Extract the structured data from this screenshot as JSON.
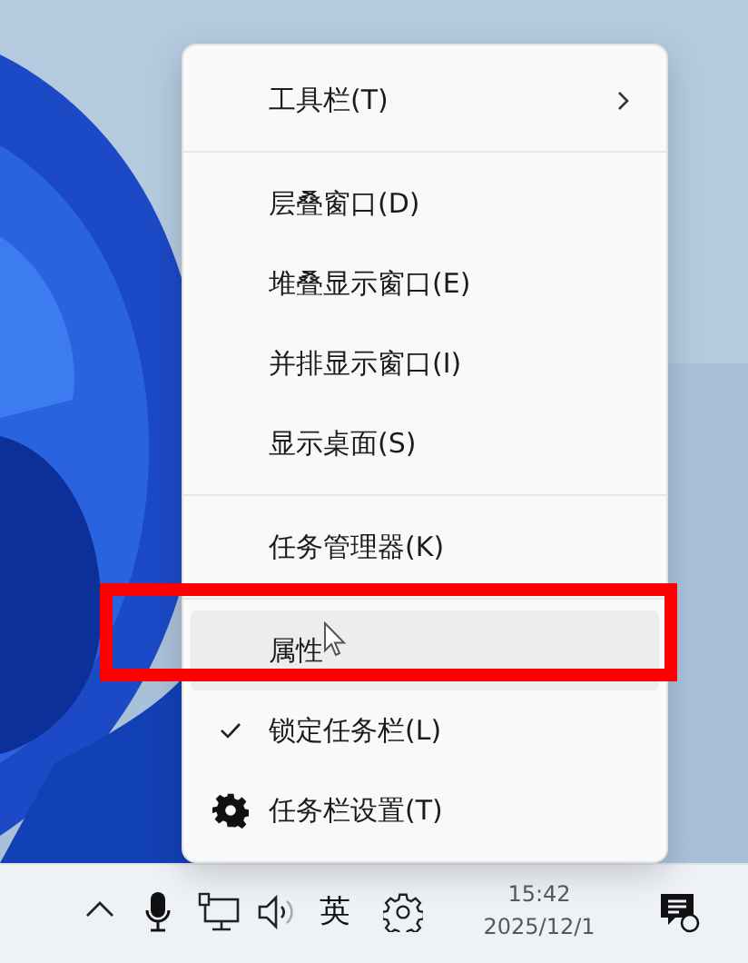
{
  "context_menu": {
    "items": [
      {
        "kind": "submenu",
        "label": "工具栏(T)",
        "selected": false
      },
      {
        "kind": "separator"
      },
      {
        "kind": "plain",
        "label": "层叠窗口(D)",
        "selected": false
      },
      {
        "kind": "plain",
        "label": "堆叠显示窗口(E)",
        "selected": false
      },
      {
        "kind": "plain",
        "label": "并排显示窗口(I)",
        "selected": false
      },
      {
        "kind": "plain",
        "label": "显示桌面(S)",
        "selected": false
      },
      {
        "kind": "separator"
      },
      {
        "kind": "plain",
        "label": "任务管理器(K)",
        "selected": false
      },
      {
        "kind": "separator"
      },
      {
        "kind": "plain",
        "label": "属性",
        "selected": true
      },
      {
        "kind": "check",
        "label": "锁定任务栏(L)",
        "checked": true,
        "selected": false
      },
      {
        "kind": "settings",
        "label": "任务栏设置(T)",
        "selected": false
      }
    ]
  },
  "taskbar": {
    "input_method": "英",
    "time": "15:42",
    "date": "2025/12/1"
  }
}
